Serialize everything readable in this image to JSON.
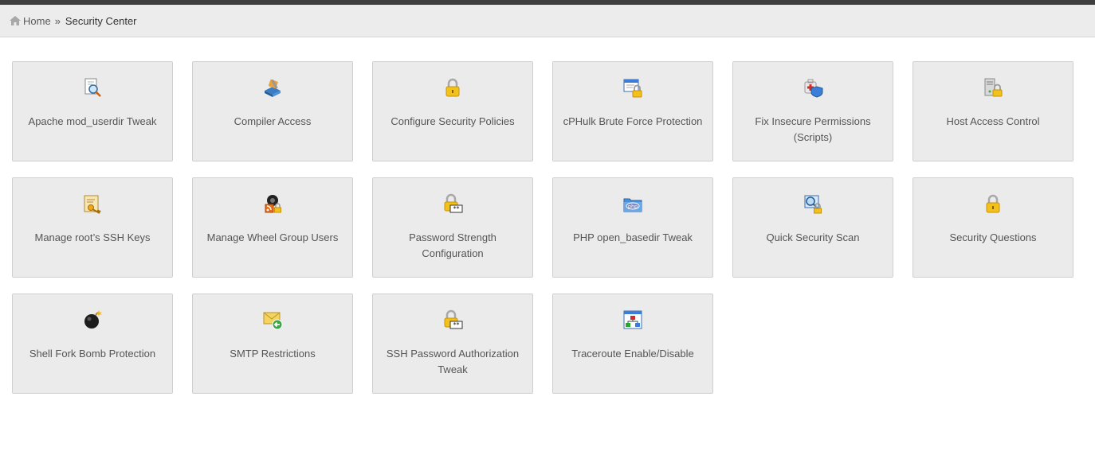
{
  "breadcrumb": {
    "home": "Home",
    "separator": "»",
    "current": "Security Center"
  },
  "tiles": [
    {
      "label": "Apache mod_userdir Tweak",
      "icon": "document-magnifier-icon"
    },
    {
      "label": "Compiler Access",
      "icon": "compiler-tools-icon"
    },
    {
      "label": "Configure Security Policies",
      "icon": "padlock-icon"
    },
    {
      "label": "cPHulk Brute Force Protection",
      "icon": "window-padlock-icon"
    },
    {
      "label": "Fix Insecure Permissions (Scripts)",
      "icon": "first-aid-shield-icon"
    },
    {
      "label": "Host Access Control",
      "icon": "server-padlock-icon"
    },
    {
      "label": "Manage root’s SSH Keys",
      "icon": "key-certificate-icon"
    },
    {
      "label": "Manage Wheel Group Users",
      "icon": "wheel-users-icon"
    },
    {
      "label": "Password Strength Configuration",
      "icon": "padlock-password-icon"
    },
    {
      "label": "PHP open_basedir Tweak",
      "icon": "php-folder-icon"
    },
    {
      "label": "Quick Security Scan",
      "icon": "scan-magnifier-icon"
    },
    {
      "label": "Security Questions",
      "icon": "padlock-icon"
    },
    {
      "label": "Shell Fork Bomb Protection",
      "icon": "bomb-icon"
    },
    {
      "label": "SMTP Restrictions",
      "icon": "envelope-arrow-icon"
    },
    {
      "label": "SSH Password Authorization Tweak",
      "icon": "padlock-password-icon"
    },
    {
      "label": "Traceroute Enable/Disable",
      "icon": "network-diagram-icon"
    }
  ]
}
